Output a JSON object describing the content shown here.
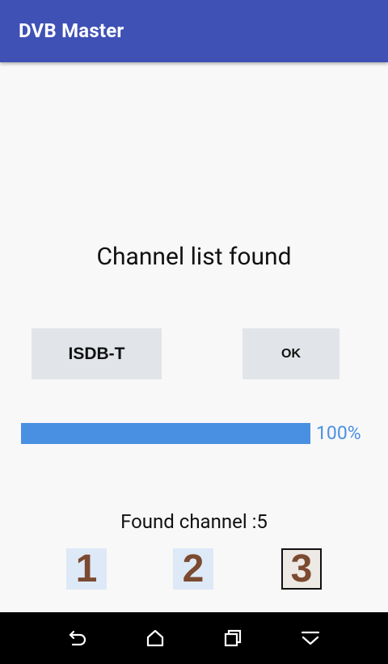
{
  "app": {
    "title": "DVB Master"
  },
  "main": {
    "heading": "Channel list found",
    "standard_button": "ISDB-T",
    "ok_button": "OK",
    "progress": {
      "value": 100,
      "label": "100%"
    },
    "found_text": "Found channel :5",
    "numbers": [
      "1",
      "2",
      "3"
    ]
  },
  "colors": {
    "appbar": "#3f51b5",
    "progress": "#4a90e2",
    "button": "#e1e4e8"
  },
  "navbar": {
    "icons": [
      "back-icon",
      "home-icon",
      "recents-icon",
      "hide-keyboard-icon"
    ]
  }
}
